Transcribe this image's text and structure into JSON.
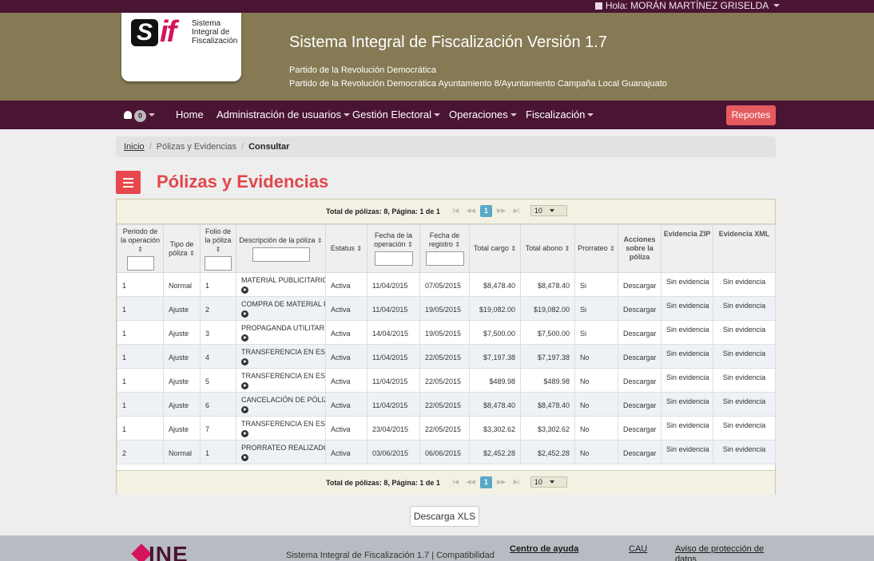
{
  "user": {
    "greeting": "Hola: MORÁN MARTÍNEZ GRISELDA"
  },
  "header": {
    "logo_caption": "Sistema Integral de Fiscalización",
    "title": "Sistema Integral de Fiscalización Versión 1.7",
    "party": "Partido de la Revolución Democrática",
    "context": "Partido de la Revolución Democrática Ayuntamiento 8/Ayuntamiento Campaña Local Guanajuato"
  },
  "nav": {
    "notifications": "0",
    "items": [
      "Home",
      "Administración de usuarios",
      "Gestión Electoral",
      "Operaciones",
      "Fiscalización"
    ],
    "reports_label": "Reportes"
  },
  "breadcrumb": {
    "home": "Inicio",
    "section": "Pólizas y Evidencias",
    "current": "Consultar"
  },
  "page": {
    "title": "Pólizas y Evidencias",
    "download_label": "Descarga XLS"
  },
  "pager": {
    "summary": "Total de pólizas: 8, Página: 1 de 1",
    "current_page": "1",
    "per_page": "10"
  },
  "table": {
    "headers": {
      "periodo": "Periodo de la operación",
      "tipo": "Tipo de póliza",
      "folio": "Folio de la póliza",
      "descripcion": "Descripción de la póliza",
      "estatus": "Estatus",
      "fecha_op": "Fecha de la operación",
      "fecha_reg": "Fecha de registro",
      "cargo": "Total cargo",
      "abono": "Total abono",
      "prorrateo": "Prorrateo",
      "acciones": "Acciones sobre la póliza",
      "zip": "Evidencia ZIP",
      "xml": "Evidencia XML"
    },
    "rows": [
      {
        "periodo": "1",
        "tipo": "Normal",
        "folio": "1",
        "descripcion": "MATERIAL PUBLICITARIO",
        "estatus": "Activa",
        "fecha_op": "11/04/2015",
        "fecha_reg": "07/05/2015",
        "cargo": "$8,478.40",
        "abono": "$8,478.40",
        "prorrateo": "Si",
        "accion": "Descargar",
        "zip": "Sin evidencia",
        "xml": "Sin evidencia"
      },
      {
        "periodo": "1",
        "tipo": "Ajuste",
        "folio": "2",
        "descripcion": "COMPRA DE MATERIAL PUBL",
        "estatus": "Activa",
        "fecha_op": "11/04/2015",
        "fecha_reg": "19/05/2015",
        "cargo": "$19,082.00",
        "abono": "$19,082.00",
        "prorrateo": "Si",
        "accion": "Descargar",
        "zip": "Sin evidencia",
        "xml": "Sin evidencia"
      },
      {
        "periodo": "1",
        "tipo": "Ajuste",
        "folio": "3",
        "descripcion": "PROPAGANDA UTILITARIA",
        "estatus": "Activa",
        "fecha_op": "14/04/2015",
        "fecha_reg": "19/05/2015",
        "cargo": "$7,500.00",
        "abono": "$7,500.00",
        "prorrateo": "Si",
        "accion": "Descargar",
        "zip": "Sin evidencia",
        "xml": "Sin evidencia"
      },
      {
        "periodo": "1",
        "tipo": "Ajuste",
        "folio": "4",
        "descripcion": "TRANSFERENCIA EN ESPECIE",
        "estatus": "Activa",
        "fecha_op": "11/04/2015",
        "fecha_reg": "22/05/2015",
        "cargo": "$7,197.38",
        "abono": "$7,197.38",
        "prorrateo": "No",
        "accion": "Descargar",
        "zip": "Sin evidencia",
        "xml": "Sin evidencia"
      },
      {
        "periodo": "1",
        "tipo": "Ajuste",
        "folio": "5",
        "descripcion": "TRANSFERENCIA EN ESPECIE",
        "estatus": "Activa",
        "fecha_op": "11/04/2015",
        "fecha_reg": "22/05/2015",
        "cargo": "$489.98",
        "abono": "$489.98",
        "prorrateo": "No",
        "accion": "Descargar",
        "zip": "Sin evidencia",
        "xml": "Sin evidencia"
      },
      {
        "periodo": "1",
        "tipo": "Ajuste",
        "folio": "6",
        "descripcion": "CANCELACIÓN DE PÓLIZA NÚ",
        "estatus": "Activa",
        "fecha_op": "11/04/2015",
        "fecha_reg": "22/05/2015",
        "cargo": "$8,478.40",
        "abono": "$8,478.40",
        "prorrateo": "No",
        "accion": "Descargar",
        "zip": "Sin evidencia",
        "xml": "Sin evidencia"
      },
      {
        "periodo": "1",
        "tipo": "Ajuste",
        "folio": "7",
        "descripcion": "TRANSFERENCIA EN ESPECIE",
        "estatus": "Activa",
        "fecha_op": "23/04/2015",
        "fecha_reg": "22/05/2015",
        "cargo": "$3,302.62",
        "abono": "$3,302.62",
        "prorrateo": "No",
        "accion": "Descargar",
        "zip": "Sin evidencia",
        "xml": "Sin evidencia"
      },
      {
        "periodo": "2",
        "tipo": "Normal",
        "folio": "1",
        "descripcion": "PRORRATEO REALIZADO PO",
        "estatus": "Activa",
        "fecha_op": "03/06/2015",
        "fecha_reg": "06/06/2015",
        "cargo": "$2,452.28",
        "abono": "$2,452.28",
        "prorrateo": "No",
        "accion": "Descargar",
        "zip": "Sin evidencia",
        "xml": "Sin evidencia"
      }
    ]
  },
  "footer": {
    "logo": "INE",
    "text": "Sistema Integral de Fiscalización 1.7 | Compatibilidad",
    "help": "Centro de ayuda",
    "cau": "CAU",
    "privacy": "Aviso de protección de datos"
  },
  "colors": {
    "brand_dark": "#4a1433",
    "header_olive": "#857a54",
    "accent_red": "#e2474b",
    "pager_blue": "#5aa8c7"
  },
  "icons": [
    "bell-icon",
    "user-icon",
    "hamburger-menu-icon",
    "arrow-circle-icon",
    "sort-icon",
    "chevron-down-icon"
  ]
}
